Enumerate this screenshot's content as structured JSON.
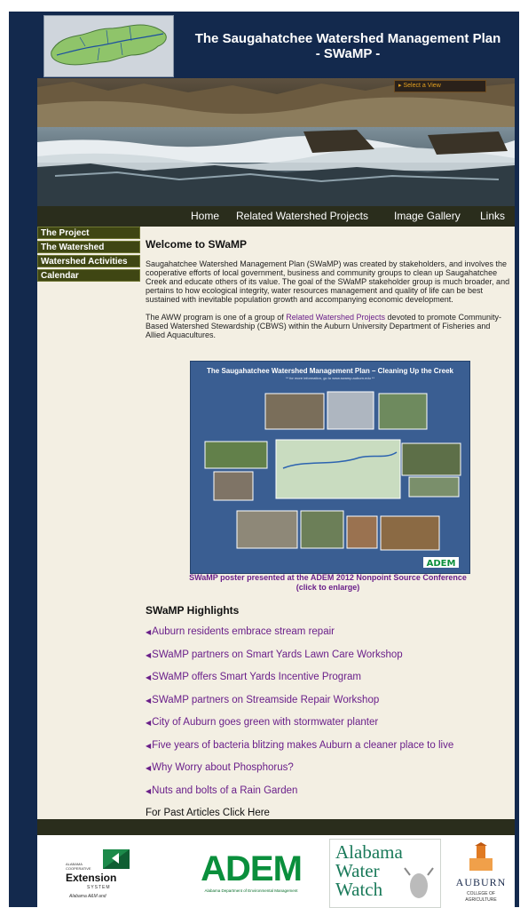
{
  "header": {
    "title_line1": "The Saugahatchee Watershed Management Plan",
    "title_line2": "- SWaMP -",
    "logo_icon": "watershed-map-icon"
  },
  "hero": {
    "select_view": "Select a View"
  },
  "topnav": {
    "items": [
      "Home",
      "Related Watershed Projects",
      "Image Gallery",
      "Links"
    ]
  },
  "sidenav": {
    "items": [
      "The Project",
      "The Watershed",
      "Watershed Activities",
      "Calendar"
    ]
  },
  "main": {
    "welcome_title": "Welcome to SWaMP",
    "para1": "Saugahatchee Watershed Management Plan (SWaMP) was created by stakeholders, and involves the cooperative efforts of local government, business and community groups to clean up Saugahatchee Creek and educate others of its value. The goal of the SWaMP stakeholder group is much broader, and pertains to how ecological integrity, water resources management and quality of life can be best sustained with inevitable population growth and accompanying economic development.",
    "para2_before": "The AWW program is one of a group of ",
    "para2_link": "Related Watershed Projects",
    "para2_after": " devoted to promote Community-Based Watershed Stewardship (CBWS) within the Auburn University Department of Fisheries and Allied Aquacultures.",
    "poster_title": "The Saugahatchee Watershed Management Plan – Cleaning Up the Creek",
    "poster_subtitle": "** for more information, go to www.swamp.auburn.edu **",
    "poster_caption_line1": "SWaMP poster presented at the ADEM 2012 Nonpoint Source Conference",
    "poster_caption_line2": "(click to enlarge)",
    "highlights_title": "SWaMP Highlights",
    "highlights": [
      "Auburn residents embrace stream repair",
      "SWaMP partners on Smart Yards Lawn Care Workshop",
      "SWaMP offers Smart Yards Incentive Program",
      "SWaMP partners on Streamside Repair Workshop",
      "City of Auburn goes green with stormwater planter",
      "Five years of bacteria blitzing makes Auburn a cleaner place to live",
      "Why Worry about Phosphorus?",
      "Nuts and bolts of a Rain Garden"
    ],
    "past_articles": "For Past Articles Click Here"
  },
  "footer": {
    "ext_top": "ALABAMA",
    "ext_mid": "COOPERATIVE",
    "ext_name": "Extension",
    "ext_system": "SYSTEM",
    "ext_sub": "Alabama A&M and",
    "adem": "ADEM",
    "adem_sub": "Alabama Department of Environmental Management",
    "aww": [
      "Alabama",
      "Water",
      "Watch"
    ],
    "auburn": "AUBURN",
    "auburn_sub1": "COLLEGE OF",
    "auburn_sub2": "AGRICULTURE"
  },
  "colors": {
    "navy": "#13294d",
    "olive_nav": "#3f4613",
    "link_purple": "#6a1f8a",
    "adem_green": "#0a8f3c"
  }
}
